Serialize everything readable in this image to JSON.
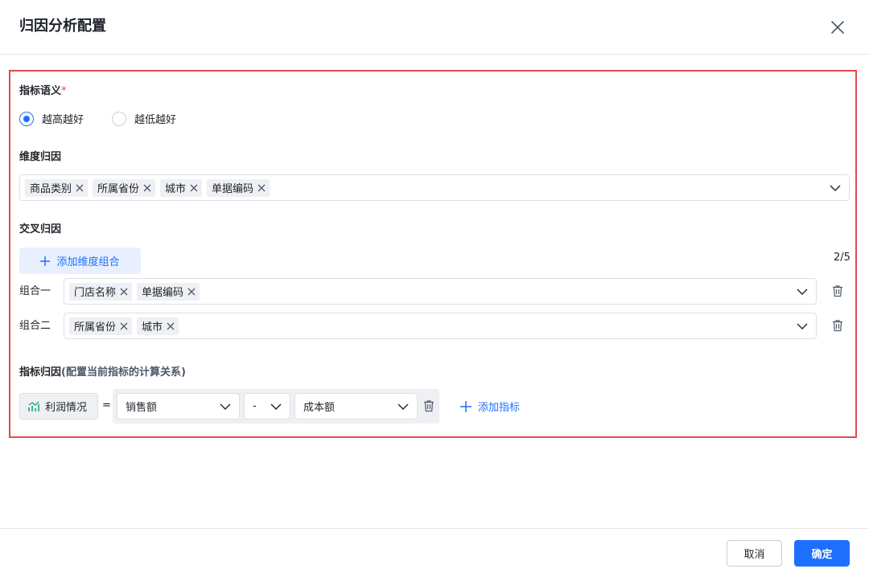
{
  "dialog": {
    "title": "归因分析配置",
    "close_icon": "close-icon"
  },
  "indicator_semantic": {
    "label": "指标语义",
    "required_mark": "*",
    "options": [
      {
        "label": "越高越好",
        "checked": true
      },
      {
        "label": "越低越好",
        "checked": false
      }
    ]
  },
  "dimension_attribution": {
    "label": "维度归因",
    "tags": [
      "商品类别",
      "所属省份",
      "城市",
      "单据编码"
    ]
  },
  "cross_attribution": {
    "label": "交叉归因",
    "add_button": "添加维度组合",
    "count": "2/5",
    "groups": [
      {
        "label": "组合一",
        "tags": [
          "门店名称",
          "单据编码"
        ]
      },
      {
        "label": "组合二",
        "tags": [
          "所属省份",
          "城市"
        ]
      }
    ]
  },
  "metric_attribution": {
    "label": "指标归因",
    "sublabel": "(配置当前指标的计算关系)",
    "metric": "利润情况",
    "equals": "=",
    "operand_1": "销售额",
    "operator": "-",
    "operand_2": "成本额",
    "add_metric": "添加指标"
  },
  "footer": {
    "cancel": "取消",
    "confirm": "确定"
  },
  "colors": {
    "primary": "#1f6fff",
    "highlight_border": "#e5484d",
    "required": "#f53f3f",
    "metric_icon": "#14a77a"
  }
}
